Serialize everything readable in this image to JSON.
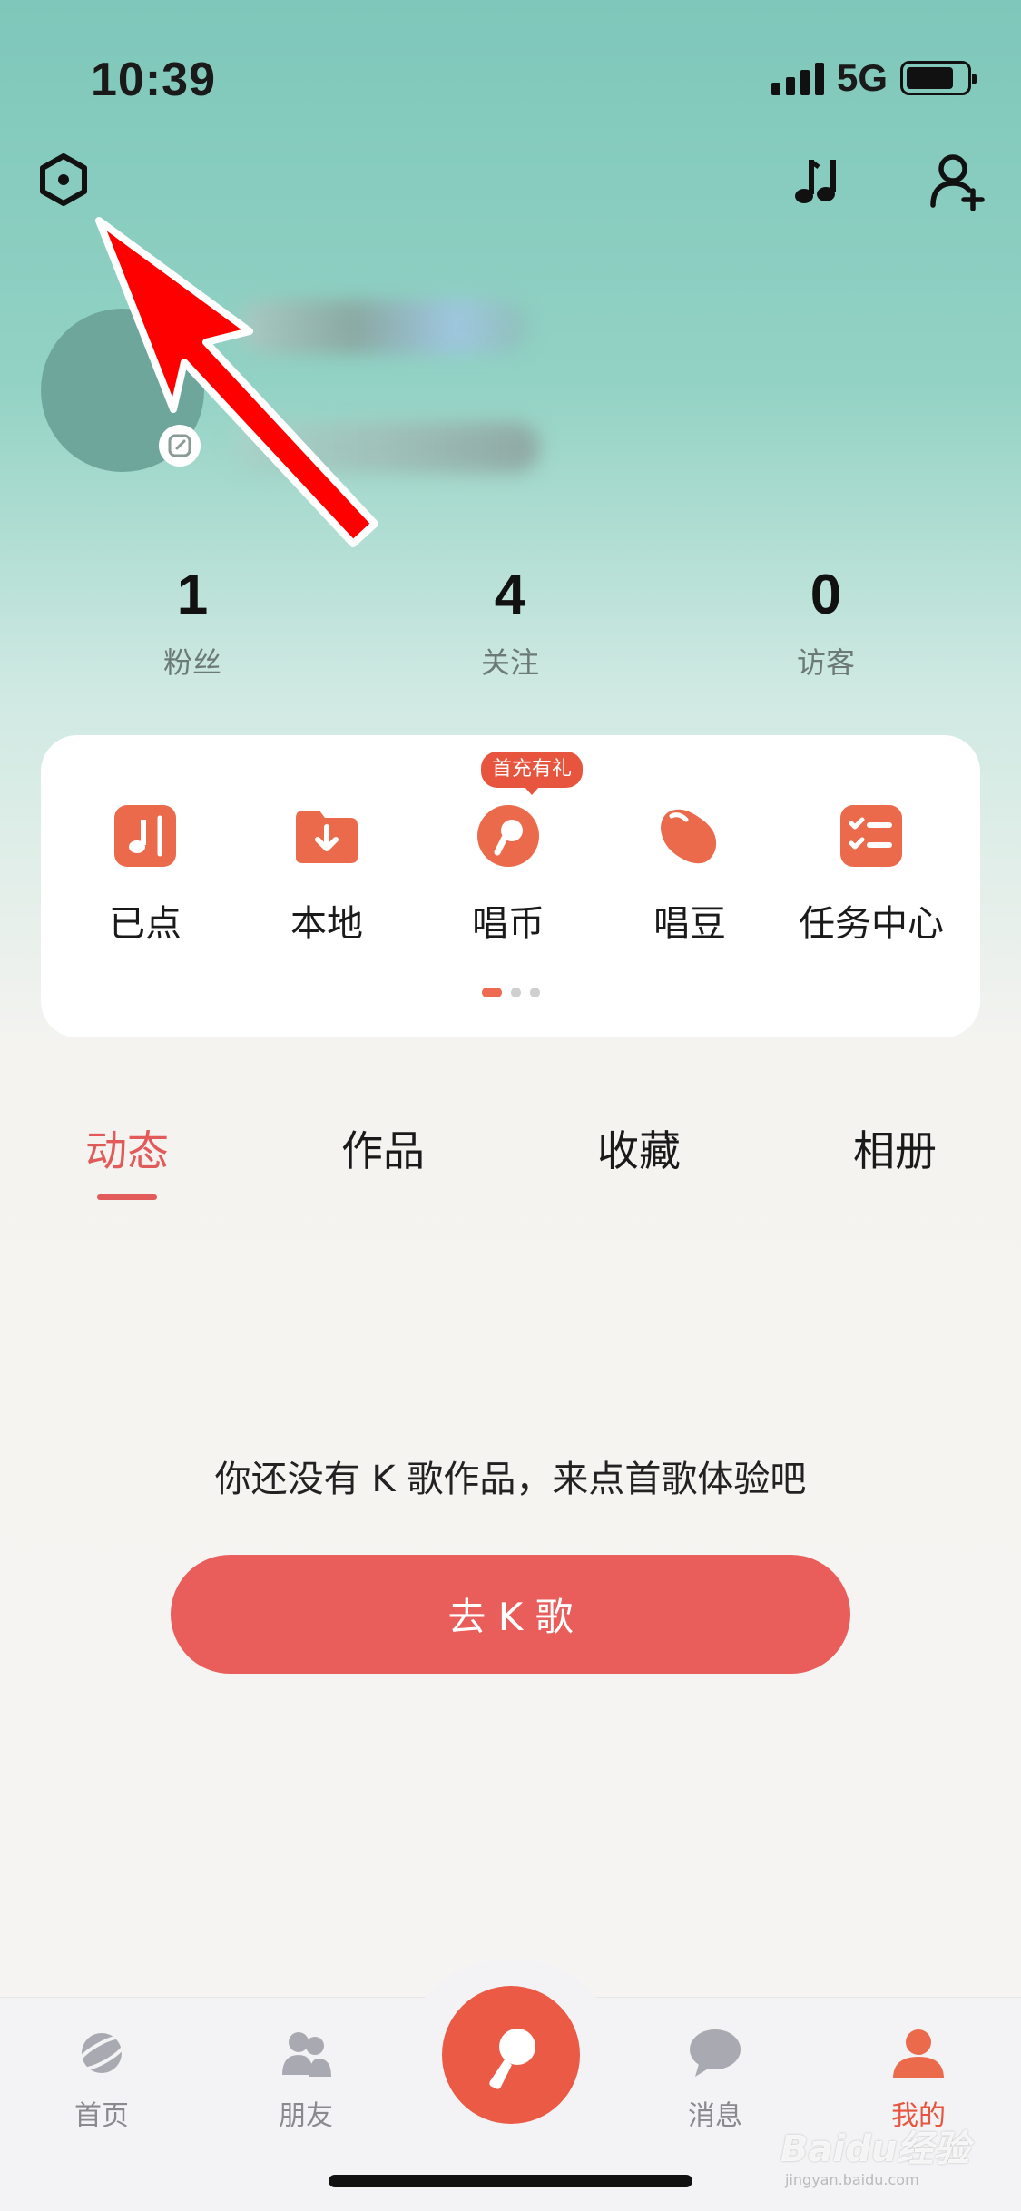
{
  "status_bar": {
    "time": "10:39",
    "network": "5G"
  },
  "stats": [
    {
      "value": "1",
      "label": "粉丝"
    },
    {
      "value": "4",
      "label": "关注"
    },
    {
      "value": "0",
      "label": "访客"
    }
  ],
  "quick_actions": {
    "items": [
      {
        "label": "已点",
        "icon": "music-note-icon"
      },
      {
        "label": "本地",
        "icon": "download-folder-icon"
      },
      {
        "label": "唱币",
        "icon": "coin-icon"
      },
      {
        "label": "唱豆",
        "icon": "bean-icon"
      },
      {
        "label": "任务中心",
        "icon": "task-list-icon"
      }
    ],
    "promo_badge": "首充有礼",
    "page_count": 3,
    "active_page": 1
  },
  "tabs": [
    {
      "label": "动态",
      "active": true
    },
    {
      "label": "作品",
      "active": false
    },
    {
      "label": "收藏",
      "active": false
    },
    {
      "label": "相册",
      "active": false
    }
  ],
  "empty_state": {
    "message": "你还没有 K 歌作品，来点首歌体验吧",
    "button": "去 K 歌"
  },
  "bottom_nav": [
    {
      "label": "首页",
      "icon": "planet-icon",
      "active": false
    },
    {
      "label": "朋友",
      "icon": "friends-icon",
      "active": false
    },
    {
      "label": "消息",
      "icon": "chat-bubble-icon",
      "active": false
    },
    {
      "label": "我的",
      "icon": "person-icon",
      "active": true
    }
  ],
  "watermark": {
    "text": "Baidu经验",
    "sub": "jingyan.baidu.com"
  },
  "colors": {
    "accent": "#e8553f",
    "active_tab": "#e35a5a",
    "button": "#e95d5b",
    "annotation_arrow": "#ff0000"
  }
}
